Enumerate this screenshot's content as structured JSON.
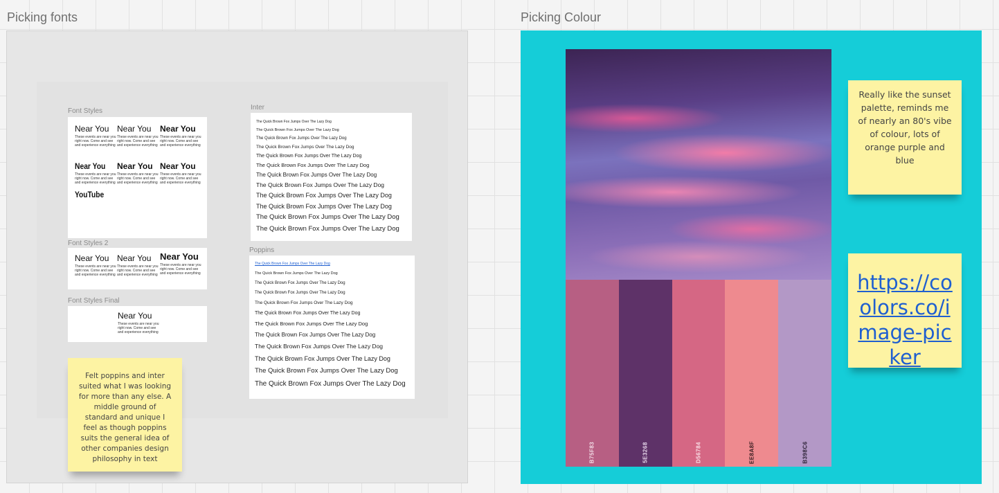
{
  "fonts_frame": {
    "title": "Picking fonts",
    "font_styles": {
      "label": "Font Styles",
      "cells": [
        {
          "title": "Near You",
          "body": "These events are near you right now. Come and see and experience everything"
        },
        {
          "title": "Near You",
          "body": "These events are near you right now. Come and see and experience everything"
        },
        {
          "title": "Near You",
          "body": "These events are near you right now. Come and see and experience everything"
        },
        {
          "title": "Near You",
          "body": "These events are near you right now. Come and see and experience everything"
        },
        {
          "title": "Near You",
          "body": "These events are near you right now. Come and see and experience everything"
        },
        {
          "title": "Near You",
          "body": "These events are near you right now. Come and see and experience everything"
        }
      ],
      "youtube": "YouTube"
    },
    "font_styles_2": {
      "label": "Font Styles 2",
      "cells": [
        {
          "title": "Near You",
          "body": "These events are near you right now. Come and see and experience everything"
        },
        {
          "title": "Near You",
          "body": "These events are near you right now. Come and see and experience everything"
        },
        {
          "title": "Near You",
          "body": "These events are near you right now. Come and see and experience everything"
        }
      ]
    },
    "font_styles_final": {
      "label": "Font Styles Final",
      "title": "Near You",
      "body": "These events are near you right now. Come and see and experience everything"
    },
    "inter": {
      "label": "Inter",
      "samples": [
        "The Quick Brown Fox Jumps Over The Lazy Dog",
        "The Quick Brown Fox Jumps Over The Lazy Dog",
        "The Quick Brown Fox Jumps Over The Lazy Dog",
        "The Quick Brown Fox Jumps Over The Lazy Dog",
        "The Quick Brown Fox Jumps Over The Lazy Dog",
        "The Quick Brown Fox Jumps Over The Lazy Dog",
        "The Quick Brown Fox Jumps Over The Lazy Dog",
        "The Quick Brown Fox Jumps Over The Lazy Dog",
        "The Quick Brown Fox Jumps Over The Lazy Dog",
        "The Quick Brown Fox Jumps Over The Lazy Dog",
        "The Quick Brown Fox Jumps Over The Lazy Dog",
        "The Quick Brown Fox Jumps Over The Lazy Dog"
      ]
    },
    "poppins": {
      "label": "Poppins",
      "samples": [
        "The Quick Brown Fox Jumps Over The Lazy Dog",
        "The Quick Brown Fox Jumps Over The Lazy Dog",
        "The Quick Brown Fox Jumps Over The Lazy Dog",
        "The Quick Brown Fox Jumps Over The Lazy Dog",
        "The Quick Brown Fox Jumps Over The Lazy Dog",
        "The Quick Brown Fox Jumps Over The Lazy Dog",
        "The Quick Brown Fox Jumps Over The Lazy Dog",
        "The Quick Brown Fox Jumps Over The Lazy Dog",
        "The Quick Brown Fox Jumps Over The Lazy Dog",
        "The Quick Brown Fox Jumps Over The Lazy Dog",
        "The Quick Brown Fox Jumps Over The Lazy Dog",
        "The Quick Brown Fox Jumps Over The Lazy Dog",
        "The Quick Brown Fox Jumps Over The Lazy Dog"
      ]
    },
    "sticky_note": "Felt poppins and inter suited what I was looking for more than any else. A middle ground of standard and unique I feel as though poppins suits the general idea of other companies design philosophy in text"
  },
  "colour_frame": {
    "title": "Picking Colour",
    "swatches": [
      {
        "code": "B75F83",
        "color": "#b75f83",
        "text_color": "#f2dbe5"
      },
      {
        "code": "5E3268",
        "color": "#5e3268",
        "text_color": "#e6d5ea"
      },
      {
        "code": "D56784",
        "color": "#d56784",
        "text_color": "#fae0e7"
      },
      {
        "code": "EE8A8F",
        "color": "#ee8a8f",
        "text_color": "#3a1f22"
      },
      {
        "code": "B398C6",
        "color": "#b398c6",
        "text_color": "#2c2236"
      }
    ],
    "sticky_note": "Really like the sunset palette, reminds me of nearly an 80's vibe of colour, lots of orange purple and blue",
    "link_note": "https://coolors.co/image-picker"
  }
}
